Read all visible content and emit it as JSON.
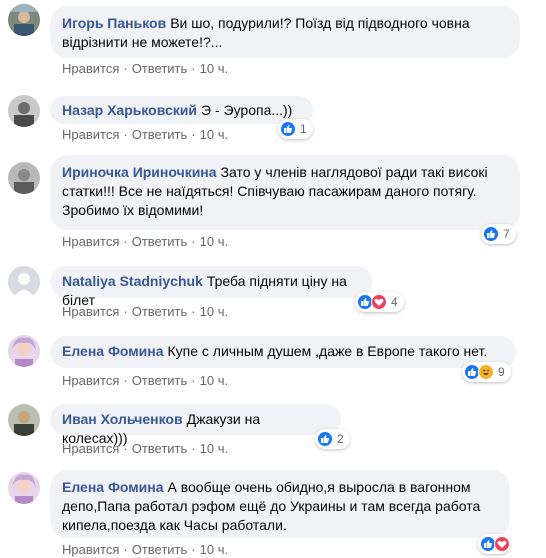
{
  "colors": {
    "author": "#385898",
    "bubble": "#f0f2f5",
    "meta": "#65676b",
    "like": "#1877f2",
    "love": "#f33e58",
    "haha": "#f7b125"
  },
  "comments": [
    {
      "author": "Игорь Паньков",
      "text": "Ви шо, подурили!? Поїзд від підводного човна відрізнити не можете!?...",
      "like": "Нравится",
      "reply": "Ответить",
      "time": "10 ч.",
      "reactions": "",
      "avatar_icon": "user-avatar"
    },
    {
      "author": "Назар Харьковский",
      "text": "Э - Эуропа...))",
      "like": "Нравится",
      "reply": "Ответить",
      "time": "10 ч.",
      "reactions": "1",
      "avatar_icon": "user-avatar"
    },
    {
      "author": "Ириночка Ириночкина",
      "text": "Зато у членів наглядової ради такі високі статки!!! Все не наїдяться! Співчуваю пасажирам даного потягу. Зробимо їх відомими!",
      "like": "Нравится",
      "reply": "Ответить",
      "time": "10 ч.",
      "reactions": "7",
      "avatar_icon": "user-avatar"
    },
    {
      "author": "Nataliya Stadniychuk",
      "text": "Треба підняти ціну на білет",
      "like": "Нравится",
      "reply": "Ответить",
      "time": "10 ч.",
      "reactions": "4",
      "avatar_icon": "user-avatar"
    },
    {
      "author": "Елена Фомина",
      "text": "Купе с личным душем ,даже в Европе такого нет.",
      "like": "Нравится",
      "reply": "Ответить",
      "time": "10 ч.",
      "reactions": "9",
      "avatar_icon": "user-avatar"
    },
    {
      "author": "Иван Хольченков",
      "text": "Джакузи на колесах)))",
      "like": "Нравится",
      "reply": "Ответить",
      "time": "10 ч.",
      "reactions": "2",
      "avatar_icon": "user-avatar"
    },
    {
      "author": "Елена Фомина",
      "text": "А вообще очень обидно,я выросла в вагонном депо,Папа работал рэфом ещё до Украины и там всегда работа кипела,поезда как Часы работали.",
      "like": "Нравится",
      "reply": "Ответить",
      "time": "10 ч.",
      "reactions": "",
      "avatar_icon": "user-avatar"
    }
  ]
}
